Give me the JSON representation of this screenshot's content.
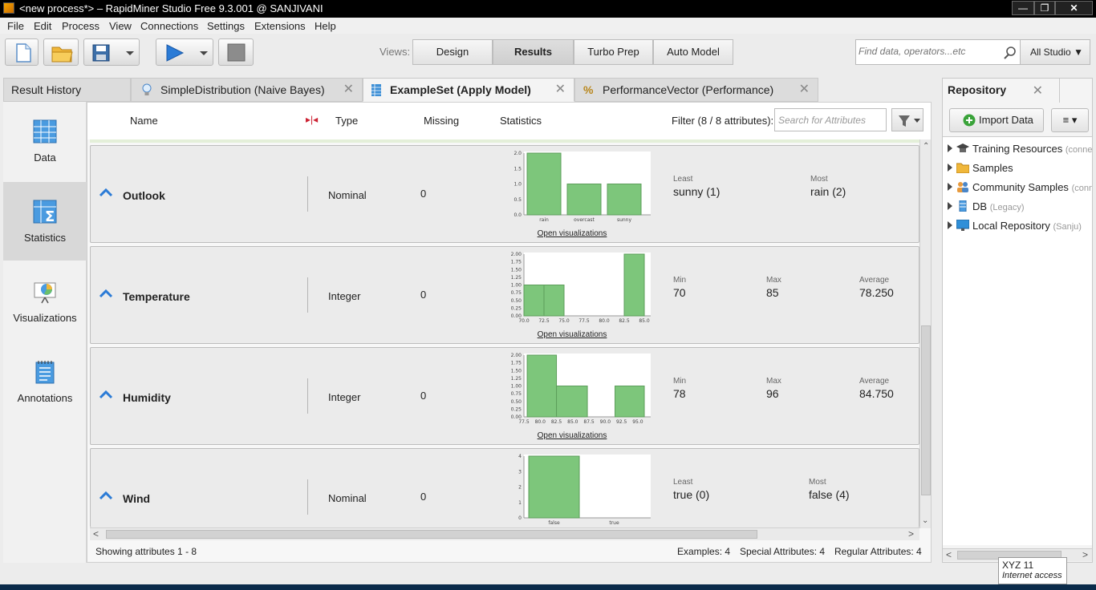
{
  "window": {
    "title": "<new process*> – RapidMiner Studio Free 9.3.001 @ SANJIVANI"
  },
  "menu": [
    "File",
    "Edit",
    "Process",
    "View",
    "Connections",
    "Settings",
    "Extensions",
    "Help"
  ],
  "views": {
    "label": "Views:",
    "tabs": [
      "Design",
      "Results",
      "Turbo Prep",
      "Auto Model"
    ],
    "active": "Results"
  },
  "search": {
    "placeholder": "Find data, operators...etc",
    "scope": "All Studio"
  },
  "doc_tabs": [
    {
      "label": "Result History"
    },
    {
      "label": "SimpleDistribution (Naive Bayes)"
    },
    {
      "label": "ExampleSet (Apply Model)"
    },
    {
      "label": "PerformanceVector (Performance)"
    }
  ],
  "nav": [
    "Data",
    "Statistics",
    "Visualizations",
    "Annotations"
  ],
  "columns": {
    "name": "Name",
    "type": "Type",
    "missing": "Missing",
    "statistics": "Statistics",
    "filter": "Filter (8 / 8 attributes):",
    "filter_placeholder": "Search for Attributes"
  },
  "attributes": [
    {
      "name": "Outlook",
      "type": "Nominal",
      "missing": "0",
      "stats": [
        {
          "label": "Least",
          "value": "sunny (1)"
        },
        {
          "label": "Most",
          "value": "rain (2)"
        }
      ],
      "open_vis": "Open visualizations",
      "chart_data": {
        "type": "bar",
        "categories": [
          "rain",
          "overcast",
          "sunny"
        ],
        "values": [
          2,
          1,
          1
        ],
        "yticks": [
          "0.0",
          "0.5",
          "1.0",
          "1.5",
          "2.0"
        ],
        "ylim": [
          0,
          2
        ]
      }
    },
    {
      "name": "Temperature",
      "type": "Integer",
      "missing": "0",
      "stats": [
        {
          "label": "Min",
          "value": "70"
        },
        {
          "label": "Max",
          "value": "85"
        },
        {
          "label": "Average",
          "value": "78.250"
        }
      ],
      "open_vis": "Open visualizations",
      "chart_data": {
        "type": "bar",
        "xticks": [
          "70.0",
          "72.5",
          "75.0",
          "77.5",
          "80.0",
          "82.5",
          "85.0"
        ],
        "bins": [
          [
            70,
            72.5
          ],
          [
            72.5,
            75
          ],
          [
            82.5,
            85
          ]
        ],
        "values": [
          1,
          1,
          2
        ],
        "yticks": [
          "0.00",
          "0.25",
          "0.50",
          "0.75",
          "1.00",
          "1.25",
          "1.50",
          "1.75",
          "2.00"
        ],
        "xlim": [
          70,
          85
        ],
        "ylim": [
          0,
          2
        ]
      }
    },
    {
      "name": "Humidity",
      "type": "Integer",
      "missing": "0",
      "stats": [
        {
          "label": "Min",
          "value": "78"
        },
        {
          "label": "Max",
          "value": "96"
        },
        {
          "label": "Average",
          "value": "84.750"
        }
      ],
      "open_vis": "Open visualizations",
      "chart_data": {
        "type": "bar",
        "xticks": [
          "77.5",
          "80.0",
          "82.5",
          "85.0",
          "87.5",
          "90.0",
          "92.5",
          "95.0"
        ],
        "bins": [
          [
            78,
            82.5
          ],
          [
            82.5,
            87.25
          ],
          [
            91.5,
            96
          ]
        ],
        "values": [
          2,
          1,
          1
        ],
        "yticks": [
          "0.00",
          "0.25",
          "0.50",
          "0.75",
          "1.00",
          "1.25",
          "1.50",
          "1.75",
          "2.00"
        ],
        "xlim": [
          77.5,
          96
        ],
        "ylim": [
          0,
          2
        ]
      }
    },
    {
      "name": "Wind",
      "type": "Nominal",
      "missing": "0",
      "stats": [
        {
          "label": "Least",
          "value": "true (0)"
        },
        {
          "label": "Most",
          "value": "false (4)"
        }
      ],
      "chart_data": {
        "type": "bar",
        "categories": [
          "false",
          "true"
        ],
        "values": [
          4,
          0
        ],
        "yticks": [
          "0",
          "1",
          "2",
          "3",
          "4"
        ],
        "ylim": [
          0,
          4
        ]
      }
    }
  ],
  "status": {
    "showing": "Showing attributes 1 - 8",
    "examples": "Examples: 4",
    "special": "Special Attributes: 4",
    "regular": "Regular Attributes: 4"
  },
  "repository": {
    "title": "Repository",
    "import_label": "Import Data",
    "items": [
      {
        "label": "Training Resources",
        "sub": "(connected)",
        "icon": "graduation-cap-icon"
      },
      {
        "label": "Samples",
        "sub": "",
        "icon": "folder-icon"
      },
      {
        "label": "Community Samples",
        "sub": "(connected)",
        "icon": "people-icon"
      },
      {
        "label": "DB",
        "sub": "(Legacy)",
        "icon": "database-icon"
      },
      {
        "label": "Local Repository",
        "sub": "(Sanju)",
        "icon": "monitor-icon"
      }
    ]
  },
  "tooltip": {
    "line1": "XYZ  11",
    "line2": "Internet access"
  },
  "colors": {
    "bar": "#7dc67b",
    "bar_stroke": "#5d9e5b",
    "accent": "#2b7bd6"
  }
}
